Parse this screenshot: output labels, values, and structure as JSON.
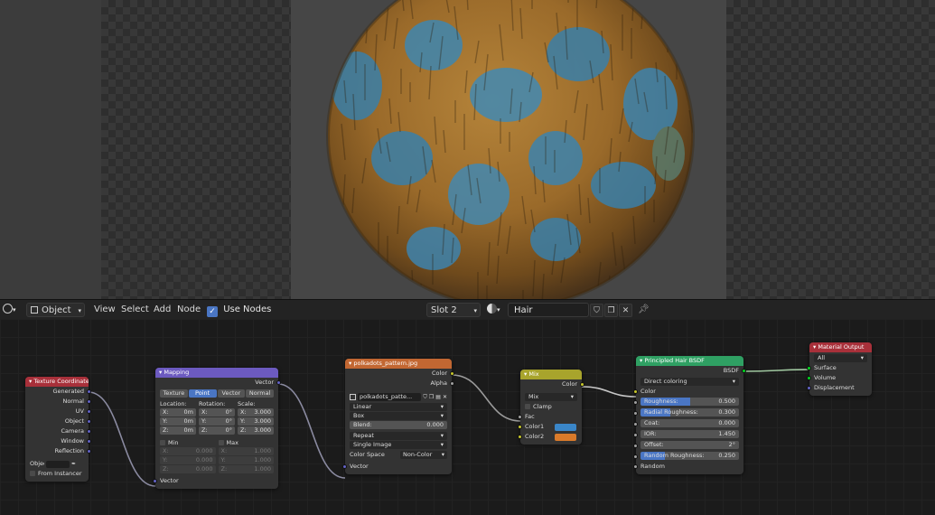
{
  "header": {
    "editor_type_icon": "shader-editor-icon",
    "object_mode": "Object",
    "menus": [
      "View",
      "Select",
      "Add",
      "Node"
    ],
    "use_nodes_label": "Use Nodes",
    "use_nodes_checked": true,
    "slot": "Slot 2",
    "material_name": "Hair"
  },
  "nodes": {
    "texcoord": {
      "title": "Texture Coordinate",
      "outputs": [
        "Generated",
        "Normal",
        "UV",
        "Object",
        "Camera",
        "Window",
        "Reflection"
      ],
      "object_label": "Object",
      "from_instancer": "From Instancer"
    },
    "mapping": {
      "title": "Mapping",
      "output": "Vector",
      "types": [
        "Texture",
        "Point",
        "Vector",
        "Normal"
      ],
      "active_type": "Point",
      "location_label": "Location:",
      "rotation_label": "Rotation:",
      "scale_label": "Scale:",
      "location": [
        {
          "a": "X:",
          "v": "0m"
        },
        {
          "a": "Y:",
          "v": "0m"
        },
        {
          "a": "Z:",
          "v": "0m"
        }
      ],
      "rotation": [
        {
          "a": "X:",
          "v": "0°"
        },
        {
          "a": "Y:",
          "v": "0°"
        },
        {
          "a": "Z:",
          "v": "0°"
        }
      ],
      "scale": [
        {
          "a": "X:",
          "v": "3.000"
        },
        {
          "a": "Y:",
          "v": "3.000"
        },
        {
          "a": "Z:",
          "v": "3.000"
        }
      ],
      "min_label": "Min",
      "max_label": "Max",
      "min": [
        {
          "a": "X:",
          "v": "0.000"
        },
        {
          "a": "Y:",
          "v": "0.000"
        },
        {
          "a": "Z:",
          "v": "0.000"
        }
      ],
      "max": [
        {
          "a": "X:",
          "v": "1.000"
        },
        {
          "a": "Y:",
          "v": "1.000"
        },
        {
          "a": "Z:",
          "v": "1.000"
        }
      ],
      "input": "Vector"
    },
    "image": {
      "title": "polkadots_pattern.jpg",
      "outputs": [
        "Color",
        "Alpha"
      ],
      "image_name": "polkadots_patte...",
      "interpolation": "Linear",
      "projection": "Box",
      "blend_label": "Blend:",
      "blend_value": "0.000",
      "extension": "Repeat",
      "source": "Single Image",
      "color_space_label": "Color Space",
      "color_space": "Non-Color",
      "input": "Vector"
    },
    "mix": {
      "title": "Mix",
      "output": "Color",
      "blend_mode": "Mix",
      "clamp_label": "Clamp",
      "inputs": [
        "Fac",
        "Color1",
        "Color2"
      ],
      "color1": "#3a86c8",
      "color2": "#d97a2a"
    },
    "hair": {
      "title": "Principled Hair BSDF",
      "output": "BSDF",
      "parametrization": "Direct coloring",
      "color_label": "Color",
      "fields": [
        {
          "label": "Roughness:",
          "value": "0.500",
          "fill": 0.5
        },
        {
          "label": "Radial Roughness:",
          "value": "0.300",
          "fill": 0.3
        },
        {
          "label": "Coat:",
          "value": "0.000",
          "fill": 0
        },
        {
          "label": "IOR:",
          "value": "1.450",
          "fill": 0
        },
        {
          "label": "Offset:",
          "value": "2°",
          "fill": 0
        },
        {
          "label": "Random Roughness:",
          "value": "0.250",
          "fill": 0.25
        }
      ],
      "random_label": "Random"
    },
    "output": {
      "title": "Material Output",
      "target": "All",
      "inputs": [
        "Surface",
        "Volume",
        "Displacement"
      ]
    }
  },
  "colors": {
    "header_input": "#a8303a",
    "header_vector": "#6c5ac0",
    "header_texture": "#c26732",
    "header_color": "#a8a42c",
    "header_shader": "#2fa063",
    "header_output": "#a8303a",
    "accent": "#4a76c4"
  }
}
